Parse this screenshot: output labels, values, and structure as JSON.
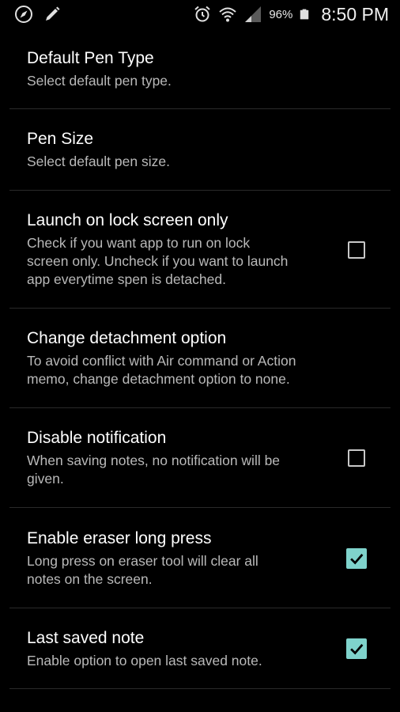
{
  "status_bar": {
    "left_icons": [
      "compass-icon",
      "pen-icon"
    ],
    "right_icons": [
      "alarm-icon",
      "wifi-icon",
      "signal-icon",
      "battery-icon"
    ],
    "battery_percent": "96%",
    "time": "8:50 PM"
  },
  "settings": [
    {
      "title": "Default Pen Type",
      "summary": "Select default pen type.",
      "has_checkbox": false
    },
    {
      "title": "Pen Size",
      "summary": "Select default pen size.",
      "has_checkbox": false
    },
    {
      "title": "Launch on lock screen only",
      "summary_lines": [
        "Check if you want app to run on lock",
        "screen only. Uncheck if you want to launch",
        "app everytime spen is detached."
      ],
      "has_checkbox": true,
      "checked": false
    },
    {
      "title": "Change detachment option",
      "summary_lines": [
        "To avoid conflict with Air command or Action",
        "memo, change detachment option to none."
      ],
      "has_checkbox": false
    },
    {
      "title": "Disable notification",
      "summary_lines": [
        "When saving notes, no notification will be",
        "given."
      ],
      "has_checkbox": true,
      "checked": false
    },
    {
      "title": "Enable eraser long press",
      "summary_lines": [
        "Long press on eraser tool will clear all",
        "notes on the screen."
      ],
      "has_checkbox": true,
      "checked": true
    },
    {
      "title": "Last saved note",
      "summary": "Enable option to open last saved note.",
      "has_checkbox": true,
      "checked": true
    }
  ],
  "colors": {
    "background": "#000000",
    "title": "#ffffff",
    "summary": "#b9b9b9",
    "checkbox_checked": "#7fd3cc",
    "divider": "#2a2a2a"
  }
}
